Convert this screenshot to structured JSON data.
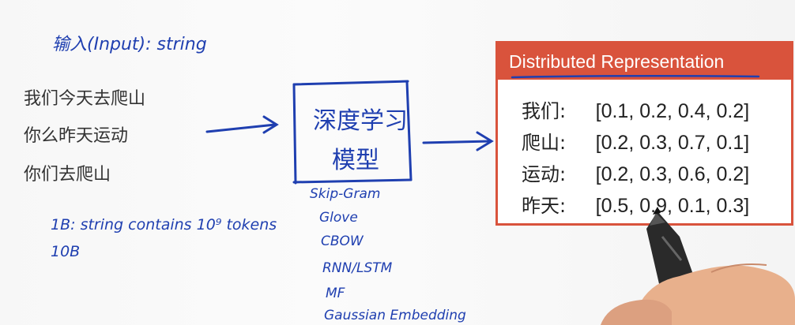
{
  "input_label": "输入(Input): string",
  "sentences": [
    "我们今天去爬山",
    "你么昨天运动",
    "你们去爬山"
  ],
  "notes": [
    "1B: string contains 10⁹ tokens",
    "10B"
  ],
  "model_box": {
    "line1": "深度学习",
    "line2": "模型"
  },
  "models": [
    "Skip-Gram",
    "Glove",
    "CBOW",
    "RNN/LSTM",
    "MF",
    "Gaussian Embedding"
  ],
  "card": {
    "title": "Distributed Representation",
    "rows": [
      {
        "term": "我们:",
        "vector": "[0.1, 0.2, 0.4, 0.2]"
      },
      {
        "term": "爬山:",
        "vector": "[0.2, 0.3, 0.7, 0.1]"
      },
      {
        "term": "运动:",
        "vector": "[0.2, 0.3, 0.6, 0.2]"
      },
      {
        "term": "昨天:",
        "vector": "[0.5, 0.9, 0.1, 0.3]"
      }
    ]
  },
  "colors": {
    "ink": "#1f3fb0",
    "card_border": "#d9533c",
    "text": "#333333"
  },
  "icons": [
    "arrow-right-icon",
    "pen-icon",
    "hand-icon"
  ]
}
